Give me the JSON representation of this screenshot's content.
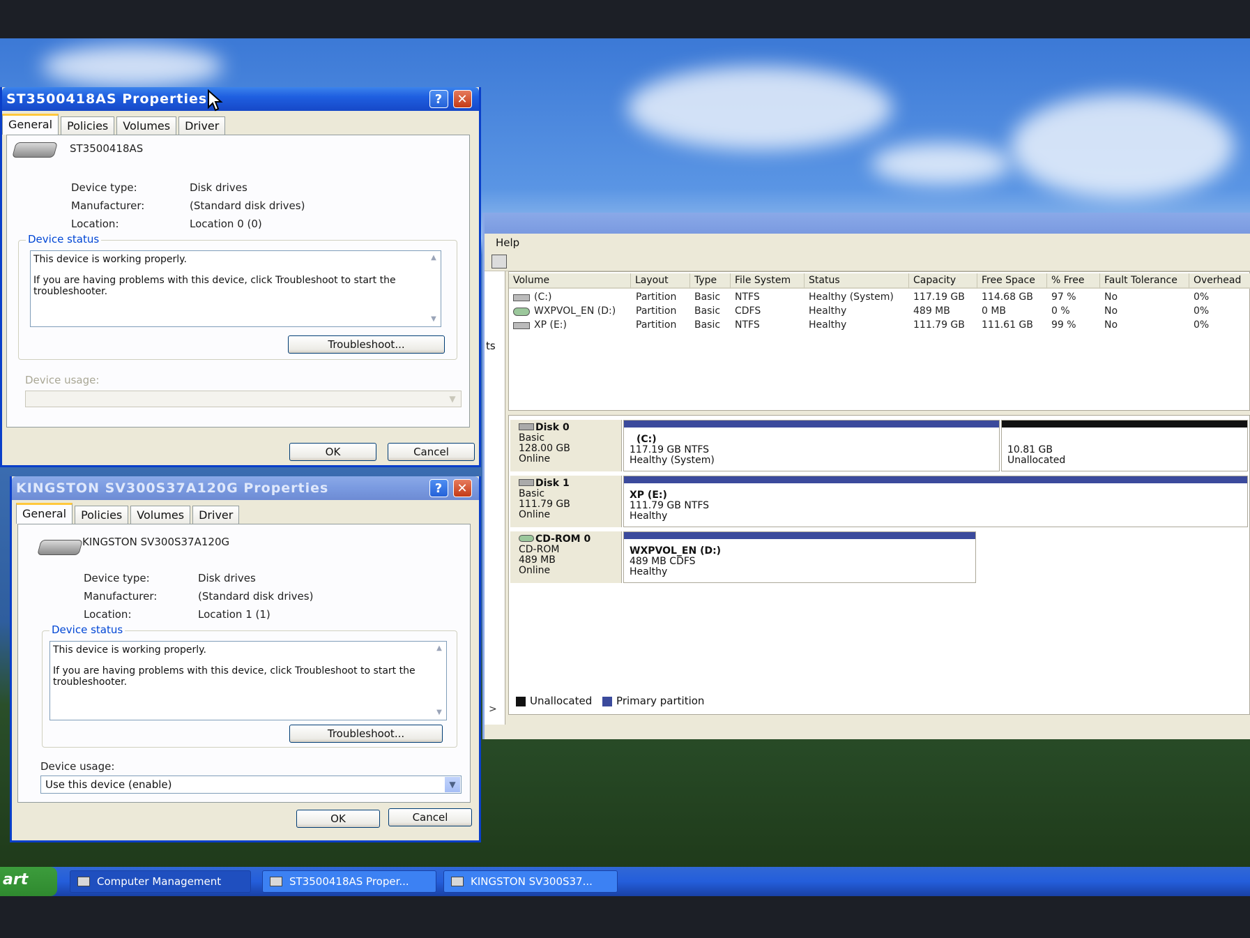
{
  "dialog1": {
    "title": "ST3500418AS Properties",
    "tabs": [
      "General",
      "Policies",
      "Volumes",
      "Driver"
    ],
    "device_name": "ST3500418AS",
    "device_type_label": "Device type:",
    "device_type_value": "Disk drives",
    "manufacturer_label": "Manufacturer:",
    "manufacturer_value": "(Standard disk drives)",
    "location_label": "Location:",
    "location_value": "Location 0 (0)",
    "device_status_label": "Device status",
    "status_line1": "This device is working properly.",
    "status_line2": "If you are having problems with this device, click Troubleshoot to start the troubleshooter.",
    "troubleshoot_label": "Troubleshoot...",
    "device_usage_label": "Device usage:",
    "device_usage_value": "",
    "ok_label": "OK",
    "cancel_label": "Cancel"
  },
  "dialog2": {
    "title": "KINGSTON SV300S37A120G Properties",
    "tabs": [
      "General",
      "Policies",
      "Volumes",
      "Driver"
    ],
    "device_name": "KINGSTON SV300S37A120G",
    "device_type_label": "Device type:",
    "device_type_value": "Disk drives",
    "manufacturer_label": "Manufacturer:",
    "manufacturer_value": "(Standard disk drives)",
    "location_label": "Location:",
    "location_value": "Location 1 (1)",
    "device_status_label": "Device status",
    "status_line1": "This device is working properly.",
    "status_line2": "If you are having problems with this device, click Troubleshoot to start the troubleshooter.",
    "troubleshoot_label": "Troubleshoot...",
    "device_usage_label": "Device usage:",
    "device_usage_value": "Use this device (enable)",
    "ok_label": "OK",
    "cancel_label": "Cancel"
  },
  "computer_management": {
    "menu_help": "Help",
    "left_pane_fragment": "ts",
    "columns": [
      "Volume",
      "Layout",
      "Type",
      "File System",
      "Status",
      "Capacity",
      "Free Space",
      "% Free",
      "Fault Tolerance",
      "Overhead"
    ],
    "volumes": [
      {
        "volume": "(C:)",
        "layout": "Partition",
        "type": "Basic",
        "fs": "NTFS",
        "status": "Healthy (System)",
        "capacity": "117.19 GB",
        "free": "114.68 GB",
        "pct": "97 %",
        "fault": "No",
        "overhead": "0%"
      },
      {
        "volume": "WXPVOL_EN (D:)",
        "layout": "Partition",
        "type": "Basic",
        "fs": "CDFS",
        "status": "Healthy",
        "capacity": "489 MB",
        "free": "0 MB",
        "pct": "0 %",
        "fault": "No",
        "overhead": "0%"
      },
      {
        "volume": "XP (E:)",
        "layout": "Partition",
        "type": "Basic",
        "fs": "NTFS",
        "status": "Healthy",
        "capacity": "111.79 GB",
        "free": "111.61 GB",
        "pct": "99 %",
        "fault": "No",
        "overhead": "0%"
      }
    ],
    "disks": [
      {
        "name": "Disk 0",
        "kind": "Basic",
        "size": "128.00 GB",
        "state": "Online",
        "partitions": [
          {
            "title": "(C:)",
            "line2": "117.19 GB NTFS",
            "line3": "Healthy (System)"
          },
          {
            "title": "",
            "line2": "10.81 GB",
            "line3": "Unallocated"
          }
        ]
      },
      {
        "name": "Disk 1",
        "kind": "Basic",
        "size": "111.79 GB",
        "state": "Online",
        "partitions": [
          {
            "title": "XP  (E:)",
            "line2": "111.79 GB NTFS",
            "line3": "Healthy"
          }
        ]
      },
      {
        "name": "CD-ROM 0",
        "kind": "CD-ROM",
        "size": "489 MB",
        "state": "Online",
        "partitions": [
          {
            "title": "WXPVOL_EN  (D:)",
            "line2": "489 MB CDFS",
            "line3": "Healthy"
          }
        ]
      }
    ],
    "legend_unallocated": "Unallocated",
    "legend_primary": "Primary partition",
    "colors": {
      "primary": "#3b4a9c",
      "unallocated": "#111111"
    }
  },
  "taskbar": {
    "start_label": "art",
    "tasks": [
      "Computer Management",
      "ST3500418AS Proper...",
      "KINGSTON SV300S37..."
    ]
  }
}
